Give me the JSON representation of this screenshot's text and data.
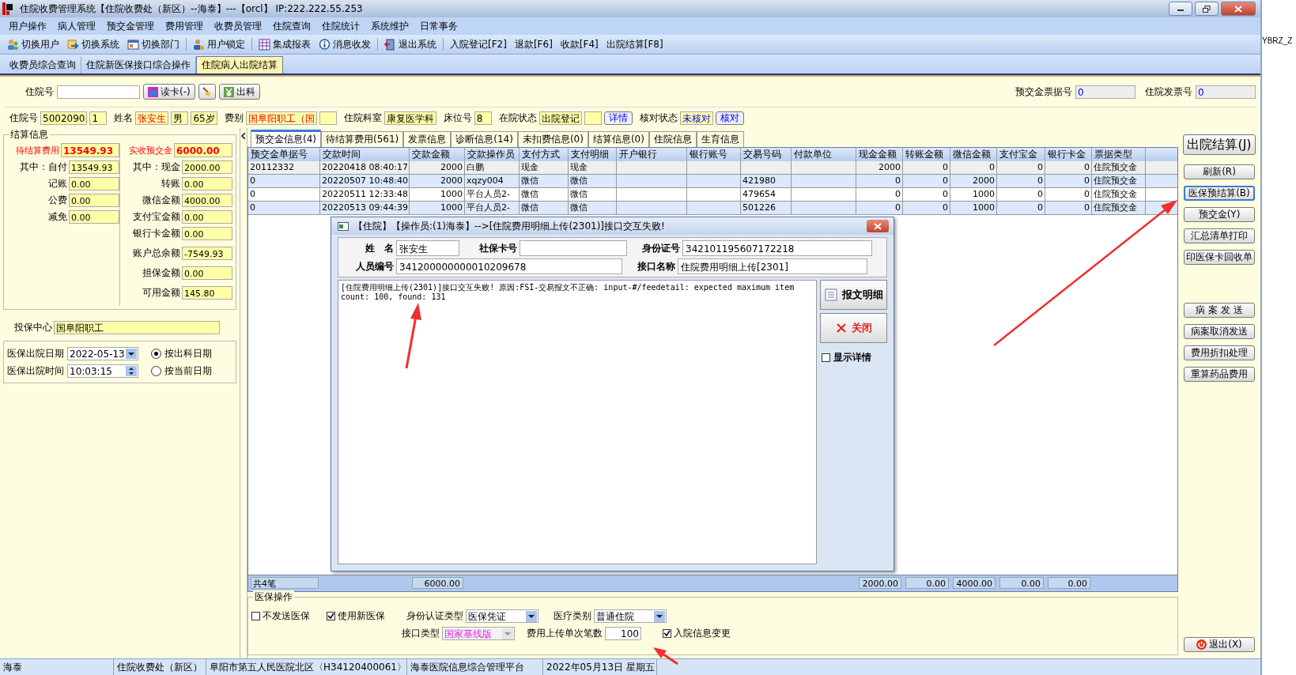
{
  "window": {
    "title": "住院收费管理系统【住院收费处（新区）--海泰】---【orcl】 IP:222.222.55.253"
  },
  "menu": [
    "用户操作",
    "病人管理",
    "预交金管理",
    "费用管理",
    "收费员管理",
    "住院查询",
    "住院统计",
    "系统维护",
    "日常事务"
  ],
  "toolbar": [
    {
      "label": "切换用户",
      "kind": "icon"
    },
    {
      "label": "切换系统",
      "kind": "icon"
    },
    {
      "label": "切换部门",
      "kind": "icon"
    },
    {
      "label": "用户锁定",
      "kind": "icon"
    },
    {
      "label": "集成报表",
      "kind": "icon"
    },
    {
      "label": "消息收发",
      "kind": "icon"
    },
    {
      "label": "退出系统",
      "kind": "icon"
    },
    {
      "label": "入院登记[F2]",
      "kind": "text"
    },
    {
      "label": "退款[F6]",
      "kind": "text"
    },
    {
      "label": "收款[F4]",
      "kind": "text"
    },
    {
      "label": "出院结算[F8]",
      "kind": "text"
    }
  ],
  "doc_tabs": [
    {
      "label": "收费员综合查询",
      "selected": false
    },
    {
      "label": "住院新医保接口综合操作",
      "selected": false
    },
    {
      "label": "住院病人出院结算",
      "selected": true
    }
  ],
  "search": {
    "label": "住院号",
    "read_card": "读卡(-)",
    "discharge": "出科",
    "receipt_label": "预交金票据号",
    "receipt": "0",
    "invoice_label": "住院发票号",
    "invoice": "0"
  },
  "patient": [
    {
      "kind": "field",
      "label": "住院号",
      "value": "5002090",
      "alert": false,
      "emphasis": false
    },
    {
      "kind": "field",
      "value": "1",
      "alert": false,
      "emphasis": false
    },
    {
      "kind": "field",
      "label": "姓名",
      "value": "张安生",
      "alert": true,
      "emphasis": false
    },
    {
      "kind": "field",
      "value": "男",
      "alert": false,
      "emphasis": false
    },
    {
      "kind": "field",
      "value": "65岁",
      "alert": false,
      "emphasis": false
    },
    {
      "kind": "field",
      "label": "费别",
      "value": "国阜阳职工（国",
      "alert": true,
      "emphasis": false
    },
    {
      "kind": "empty"
    },
    {
      "kind": "field",
      "label": "住院科室",
      "value": "康复医学科",
      "alert": false,
      "emphasis": false
    },
    {
      "kind": "field",
      "label": "床位号",
      "value": "8",
      "alert": false,
      "emphasis": false
    },
    {
      "kind": "field",
      "label": "在院状态",
      "value": "出院登记",
      "alert": false,
      "emphasis": false
    },
    {
      "kind": "empty"
    },
    {
      "kind": "button",
      "value": "详情"
    },
    {
      "kind": "field",
      "label": "核对状态",
      "value": "未核对",
      "alert": false,
      "emphasis": true
    },
    {
      "kind": "button",
      "value": "核对"
    }
  ],
  "settlement": {
    "title": "结算信息",
    "total_label": "待结算费用",
    "total": "13549.93",
    "received_label": "实收预交金",
    "received": "6000.00",
    "left": [
      {
        "label": "其中：自付",
        "value": "13549.93"
      },
      {
        "label": "记账",
        "value": "0.00"
      },
      {
        "label": "公费",
        "value": "0.00"
      },
      {
        "label": "减免",
        "value": "0.00"
      }
    ],
    "right": [
      {
        "label": "其中：现金",
        "value": "2000.00"
      },
      {
        "label": "转账",
        "value": "0.00"
      },
      {
        "label": "微信金额",
        "value": "4000.00"
      },
      {
        "label": "支付宝金额",
        "value": "0.00"
      },
      {
        "label": "银行卡金额",
        "value": "0.00"
      },
      {
        "label": "账户总余额",
        "value": "-7549.93"
      },
      {
        "label": "担保金额",
        "value": "0.00"
      },
      {
        "label": "可用金额",
        "value": "145.80"
      }
    ],
    "insurance_center": {
      "label": "投保中心",
      "value": "国阜阳职工"
    },
    "discharge_date": {
      "label": "医保出院日期",
      "value": "2022-05-13"
    },
    "discharge_time": {
      "label": "医保出院时间",
      "value": "10:03:15"
    },
    "radios": [
      {
        "label": "按出科日期",
        "selected": true
      },
      {
        "label": "按当前日期",
        "selected": false
      }
    ]
  },
  "detail_tabs": [
    {
      "label": "预交金信息(4)",
      "selected": true
    },
    {
      "label": "待结算费用(561)",
      "selected": false
    },
    {
      "label": "发票信息",
      "selected": false
    },
    {
      "label": "诊断信息(14)",
      "selected": false
    },
    {
      "label": "未扣费信息(0)",
      "selected": false
    },
    {
      "label": "结算信息(0)",
      "selected": false
    },
    {
      "label": "住院信息",
      "selected": false
    },
    {
      "label": "生育信息",
      "selected": false
    }
  ],
  "table": {
    "columns": [
      "预交金单据号",
      "交款时间",
      "交款金额",
      "交款操作员",
      "支付方式",
      "支付明细",
      "开户银行",
      "银行账号",
      "交易号码",
      "付款单位",
      "现金金额",
      "转账金额",
      "微信金额",
      "支付宝金",
      "银行卡金",
      "票据类型"
    ],
    "rows": [
      {
        "selected": true,
        "cells": [
          "20112332",
          "20220418 08:40:17",
          "2000",
          "白鹏",
          "现金",
          "现金",
          "",
          "",
          "",
          "",
          "2000",
          "0",
          "0",
          "0",
          "0",
          "住院预交金"
        ]
      },
      {
        "selected": false,
        "cells": [
          "0",
          "20220507 10:48:40",
          "2000",
          "xqzy004",
          "微信",
          "微信",
          "",
          "",
          "421980",
          "",
          "0",
          "0",
          "2000",
          "0",
          "0",
          "住院预交金"
        ]
      },
      {
        "selected": false,
        "cells": [
          "0",
          "20220511 12:33:48",
          "1000",
          "平台人员2-",
          "微信",
          "微信",
          "",
          "",
          "479654",
          "",
          "0",
          "0",
          "1000",
          "0",
          "0",
          "住院预交金"
        ]
      },
      {
        "selected": false,
        "cells": [
          "0",
          "20220513 09:44:39",
          "1000",
          "平台人员2-",
          "微信",
          "微信",
          "",
          "",
          "501226",
          "",
          "0",
          "0",
          "1000",
          "0",
          "0",
          "住院预交金"
        ]
      }
    ],
    "totals": {
      "count": "共4笔",
      "amount": "6000.00",
      "cash": "2000.00",
      "transfer": "0.00",
      "wechat": "4000.00",
      "alipay": "0.00",
      "bank_card": "0.00"
    }
  },
  "dialog": {
    "title": "【住院】【操作员:(1)海泰】-->[住院费用明细上传(2301)]接口交互失败!",
    "fields": [
      {
        "label": "姓　名",
        "value": "张安生"
      },
      {
        "label": "社保卡号"
      },
      {
        "label": "身份证号",
        "value": "342101195607172218"
      },
      {
        "label": "人员编号",
        "value": "341200000000010209678"
      },
      {
        "label": "接口名称",
        "value": "住院费用明细上传[2301]"
      }
    ],
    "message": "[住院费用明细上传(2301)]接口交互失败! 原因:FSI-交易报文不正确: input-#/feedetail: expected maximum item count: 100, found: 131",
    "detail_button": "报文明细",
    "close_button": "关闭",
    "show_details": {
      "label": "显示详情",
      "checked": false
    }
  },
  "actions": [
    {
      "label": "出院结算(J)",
      "kind": "primary",
      "selected": false
    },
    {
      "label": "刷新(R)",
      "kind": "normal",
      "selected": false
    },
    {
      "label": "医保预结算(B)",
      "kind": "normal",
      "selected": true
    },
    {
      "label": "预交金(Y)",
      "kind": "normal",
      "selected": false
    },
    {
      "label": "汇总清单打印",
      "kind": "normal",
      "selected": false
    },
    {
      "label": "印医保卡回收单",
      "kind": "normal",
      "selected": false
    },
    {
      "label": "病 案 发 送",
      "kind": "gap",
      "selected": false
    },
    {
      "label": "病案取消发送",
      "kind": "normal",
      "selected": false
    },
    {
      "label": "费用折扣处理",
      "kind": "normal",
      "selected": false
    },
    {
      "label": "重算药品费用",
      "kind": "normal",
      "selected": false
    },
    {
      "label": "退出(X)",
      "kind": "exit",
      "selected": false
    }
  ],
  "insurance_ops": {
    "title": "医保操作",
    "no_send": {
      "label": "不发送医保",
      "checked": false
    },
    "new_insurance": {
      "label": "使用新医保",
      "checked": true
    },
    "auth_type": {
      "label": "身份认证类型",
      "value": "医保凭证"
    },
    "medical_type": {
      "label": "医疗类别",
      "value": "普通住院"
    },
    "interface_type": {
      "label": "接口类型",
      "value": "国家基线版",
      "disabled": true
    },
    "batch": {
      "label": "费用上传单次笔数",
      "value": "100"
    },
    "admission_change": {
      "label": "入院信息变更",
      "checked": true
    }
  },
  "status_bar": [
    "海泰",
    "住院收费处（新区）",
    "阜阳市第五人民医院北区〈H34120400061〉",
    "海泰医院信息综合管理平台",
    "2022年05月13日 星期五"
  ],
  "background_window": {
    "text": "YBRZ_Z"
  }
}
